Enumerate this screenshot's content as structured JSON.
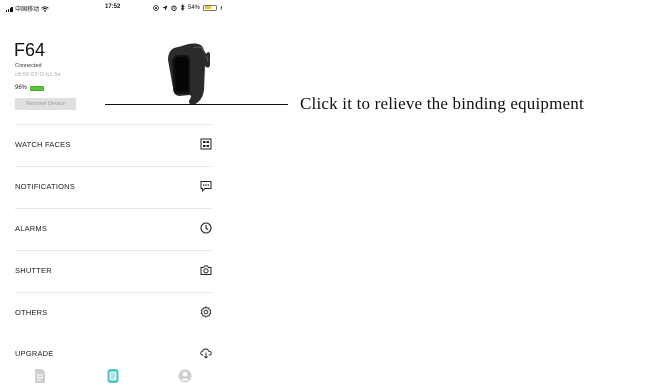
{
  "status_bar": {
    "carrier": "中国移动",
    "time": "17:52",
    "battery_text": "54%",
    "battery_level": 0.54
  },
  "device": {
    "name": "F64",
    "status": "Connected",
    "mac": "c8:56:63:f2:b1:5e",
    "battery_percent_text": "96%",
    "battery_level": 0.96,
    "remove_button_label": "Remove Device",
    "image_icon": "fitness-band-icon"
  },
  "menu": {
    "items": [
      {
        "label": "WATCH FACES",
        "icon": "watch-face-grid-icon"
      },
      {
        "label": "NOTIFICATIONS",
        "icon": "chat-bubble-icon"
      },
      {
        "label": "ALARMS",
        "icon": "clock-icon"
      },
      {
        "label": "SHUTTER",
        "icon": "camera-icon"
      },
      {
        "label": "OTHERS",
        "icon": "gear-icon"
      },
      {
        "label": "UPGRADE",
        "icon": "cloud-download-icon"
      }
    ]
  },
  "tab_bar": {
    "tabs": [
      {
        "icon": "document-icon",
        "active": false
      },
      {
        "icon": "watch-icon",
        "active": true
      },
      {
        "icon": "profile-icon",
        "active": false
      }
    ],
    "active_color": "#4ec3c8",
    "inactive_color": "#cfcfcf"
  },
  "annotation": {
    "text": "Click it to relieve the binding equipment"
  },
  "colors": {
    "battery_green": "#5ac83a",
    "status_battery_yellow": "#f2c41d",
    "divider": "#e6e6e6"
  }
}
